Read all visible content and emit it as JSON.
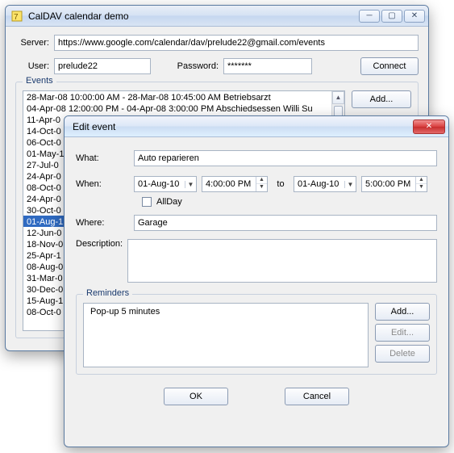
{
  "main": {
    "title": "CalDAV calendar demo",
    "serverLabel": "Server:",
    "server": "https://www.google.com/calendar/dav/prelude22@gmail.com/events",
    "userLabel": "User:",
    "user": "prelude22",
    "passwordLabel": "Password:",
    "passwordMasked": "*******",
    "connect": "Connect",
    "eventsLegend": "Events",
    "addBtn": "Add...",
    "events": [
      "28-Mar-08 10:00:00 AM - 28-Mar-08 10:45:00 AM  Betriebsarzt",
      "04-Apr-08 12:00:00 PM - 04-Apr-08 3:00:00 PM  Abschiedsessen Willi Su",
      "11-Apr-0",
      "14-Oct-0",
      "06-Oct-0",
      "01-May-1",
      "27-Jul-0",
      "24-Apr-0",
      "08-Oct-0",
      "24-Apr-0",
      "30-Oct-0",
      "01-Aug-1",
      "12-Jun-0",
      "18-Nov-0",
      "25-Apr-1",
      "08-Aug-0",
      "31-Mar-0",
      "30-Dec-0",
      "15-Aug-1",
      "08-Oct-0"
    ],
    "selectedIndex": 11
  },
  "edit": {
    "title": "Edit event",
    "whatLabel": "What:",
    "what": "Auto reparieren",
    "whenLabel": "When:",
    "startDate": "01-Aug-10",
    "startTime": "4:00:00 PM",
    "toLabel": "to",
    "endDate": "01-Aug-10",
    "endTime": "5:00:00 PM",
    "allDayLabel": "AllDay",
    "whereLabel": "Where:",
    "where": "Garage",
    "descLabel": "Description:",
    "description": "",
    "remindersLegend": "Reminders",
    "reminders": [
      "Pop-up 5 minutes"
    ],
    "addBtn": "Add...",
    "editBtn": "Edit...",
    "deleteBtn": "Delete",
    "okBtn": "OK",
    "cancelBtn": "Cancel"
  }
}
